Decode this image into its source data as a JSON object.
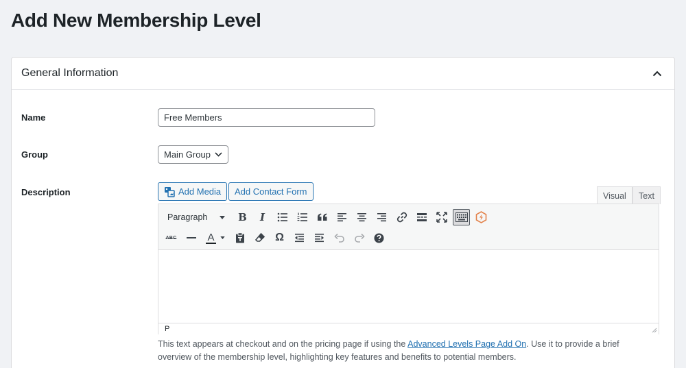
{
  "page": {
    "title": "Add New Membership Level"
  },
  "panel": {
    "title": "General Information",
    "toggle_icon": "chevron-up-icon"
  },
  "form": {
    "name": {
      "label": "Name",
      "value": "Free Members"
    },
    "group": {
      "label": "Group",
      "selected": "Main Group"
    },
    "description": {
      "label": "Description",
      "add_media_label": "Add Media",
      "add_contact_form_label": "Add Contact Form",
      "tabs": {
        "visual": "Visual",
        "text": "Text"
      },
      "format_select": "Paragraph",
      "status_path": "P",
      "help_before": "This text appears at checkout and on the pricing page if using the ",
      "help_link": "Advanced Levels Page Add On",
      "help_after": ". Use it to provide a brief overview of the membership level, highlighting key features and benefits to potential members."
    }
  },
  "toolbar": {
    "text_color_glyph": "A",
    "omega_glyph": "Ω",
    "strikethrough_glyph": "ABC",
    "bold_glyph": "B",
    "italic_glyph": "I"
  },
  "colors": {
    "link": "#2271b1",
    "brand_orange": "#e3824b"
  }
}
